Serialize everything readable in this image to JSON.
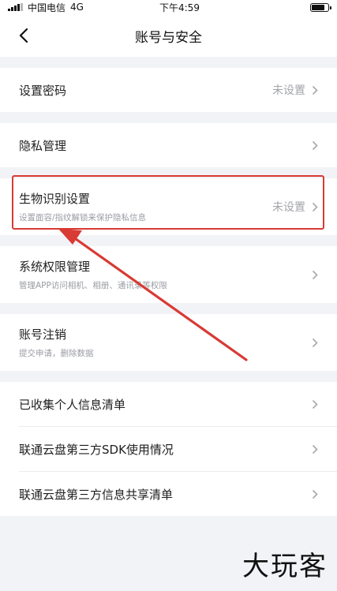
{
  "status_bar": {
    "carrier": "中国电信",
    "network": "4G",
    "time": "下午4:59"
  },
  "nav": {
    "title": "账号与安全",
    "back_icon": "chevron-left-icon"
  },
  "groups": [
    {
      "rows": [
        {
          "label": "设置密码",
          "value": "未设置"
        }
      ]
    },
    {
      "rows": [
        {
          "label": "隐私管理"
        }
      ]
    },
    {
      "rows": [
        {
          "label": "生物识别设置",
          "subtitle": "设置面容/指纹解锁来保护隐私信息",
          "value": "未设置"
        }
      ]
    },
    {
      "rows": [
        {
          "label": "系统权限管理",
          "subtitle": "管理APP访问相机、相册、通讯录等权限"
        }
      ]
    },
    {
      "rows": [
        {
          "label": "账号注销",
          "subtitle": "提交申请，删除数据"
        }
      ]
    },
    {
      "rows": [
        {
          "label": "已收集个人信息清单"
        },
        {
          "label": "联通云盘第三方SDK使用情况"
        },
        {
          "label": "联通云盘第三方信息共享清单"
        }
      ]
    }
  ],
  "annotation": {
    "highlight_color": "#d83a34",
    "arrow_color": "#d83a34"
  },
  "watermark": "大玩客"
}
